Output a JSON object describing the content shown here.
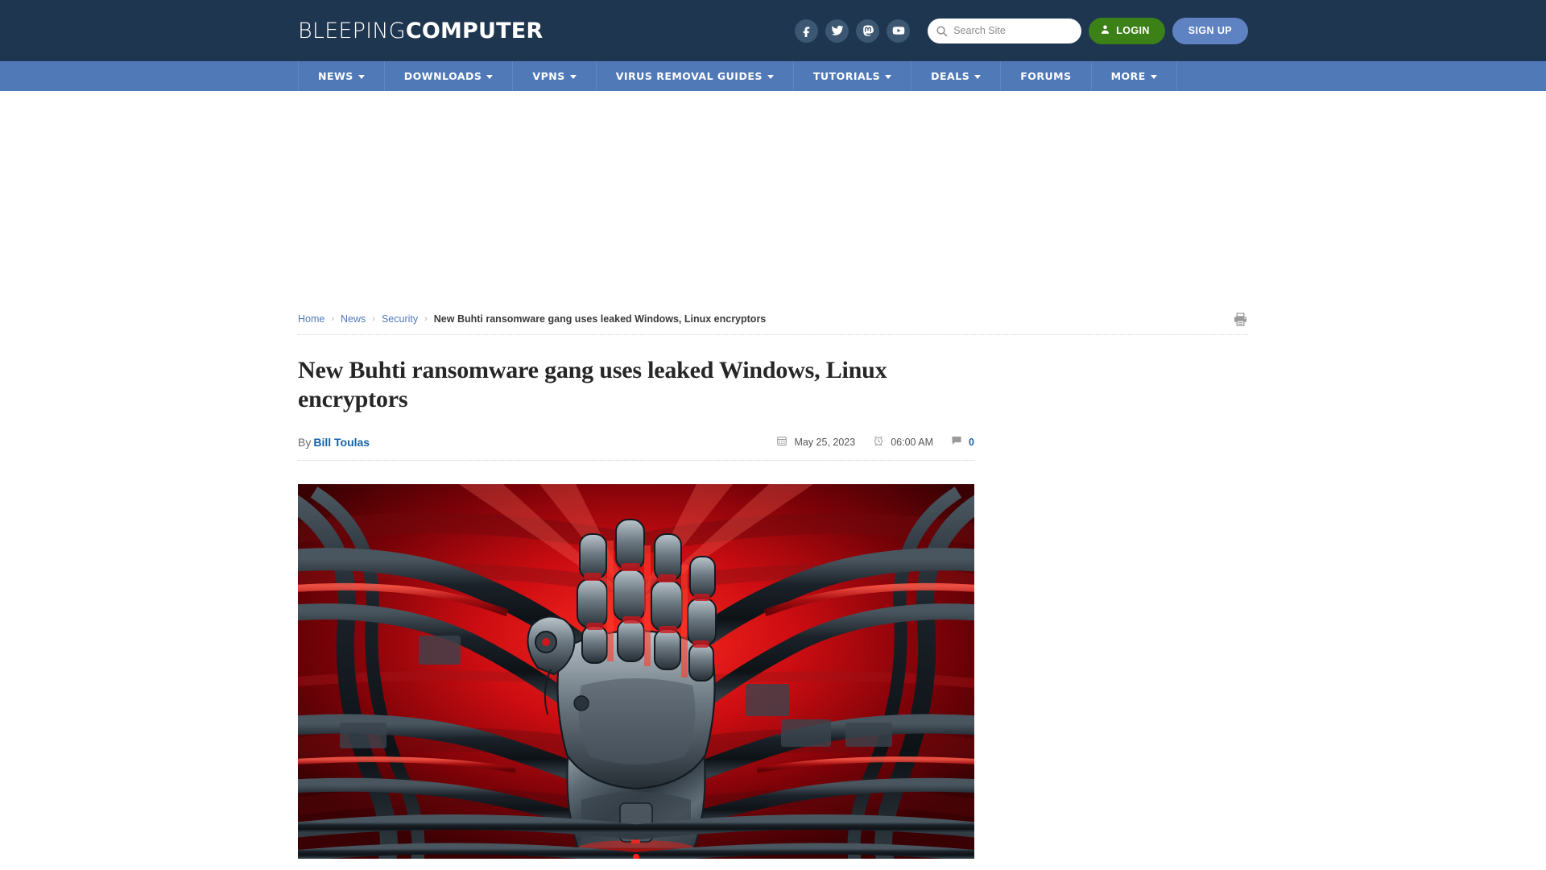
{
  "header": {
    "logo_light": "BLEEPING",
    "logo_bold": "COMPUTER",
    "social": [
      {
        "name": "facebook-icon",
        "label": "Facebook"
      },
      {
        "name": "twitter-icon",
        "label": "Twitter"
      },
      {
        "name": "mastodon-icon",
        "label": "Mastodon"
      },
      {
        "name": "youtube-icon",
        "label": "YouTube"
      }
    ],
    "search": {
      "placeholder": "Search Site",
      "value": "",
      "icon": "search-icon"
    },
    "login_label": "LOGIN",
    "signup_label": "SIGN UP",
    "login_color": "#3c8018",
    "signup_color": "#5f82c2",
    "bg_color": "#1e3650"
  },
  "nav": {
    "bg_color": "#5079b8",
    "items": [
      {
        "label": "NEWS",
        "has_dropdown": true
      },
      {
        "label": "DOWNLOADS",
        "has_dropdown": true
      },
      {
        "label": "VPNS",
        "has_dropdown": true
      },
      {
        "label": "VIRUS REMOVAL GUIDES",
        "has_dropdown": true
      },
      {
        "label": "TUTORIALS",
        "has_dropdown": true
      },
      {
        "label": "DEALS",
        "has_dropdown": true
      },
      {
        "label": "FORUMS",
        "has_dropdown": false
      },
      {
        "label": "MORE",
        "has_dropdown": true
      }
    ]
  },
  "breadcrumb": {
    "items": [
      {
        "label": "Home",
        "link": true
      },
      {
        "label": "News",
        "link": true
      },
      {
        "label": "Security",
        "link": true
      },
      {
        "label": "New Buhti ransomware gang uses leaked Windows, Linux encryptors",
        "link": false
      }
    ],
    "separator": "›",
    "print_icon": "printer-icon"
  },
  "article": {
    "title": "New Buhti ransomware gang uses leaked Windows, Linux encryptors",
    "by_prefix": "By",
    "author": "Bill Toulas",
    "date": "May 25, 2023",
    "date_icon": "calendar-icon",
    "time": "06:00 AM",
    "time_icon": "alarm-clock-icon",
    "comment_count": "0",
    "comment_icon": "comment-icon",
    "hero_image_alt": "Robotic metal hand reaching forward against a red machinery background"
  }
}
